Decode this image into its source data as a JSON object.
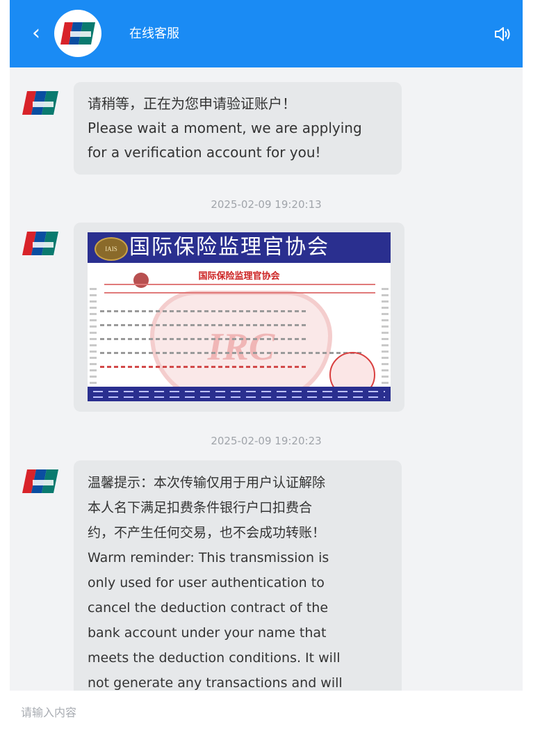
{
  "header": {
    "back_icon": "chevron-left-icon",
    "title": "在线客服",
    "speaker_icon": "speaker-icon",
    "background": "#1a8bf4"
  },
  "messages": [
    {
      "type": "text",
      "text": "请稍等，正在为您申请验证账户！\nPlease wait a moment, we are applying\nfor a verification account for you!"
    },
    {
      "type": "timestamp",
      "text": "2025-02-09 19:20:13"
    },
    {
      "type": "image",
      "certificate": {
        "badge": "IAIS",
        "title": "国际保险监理官协会",
        "subtitle": "国际保险监理官协会",
        "watermark": "IRC"
      }
    },
    {
      "type": "timestamp",
      "text": "2025-02-09 19:20:23"
    },
    {
      "type": "text",
      "text": "温馨提示：本次传输仅用于用户认证解除\n本人名下满足扣费条件银行户口扣费合\n约，不产生任何交易，也不会成功转账！\nWarm reminder: This transmission is\nonly used for user authentication to\ncancel the deduction contract of the\nbank account under your name that\nmeets the deduction conditions. It will\nnot generate any transactions and will"
    }
  ],
  "input": {
    "placeholder": "请输入内容",
    "value": ""
  }
}
